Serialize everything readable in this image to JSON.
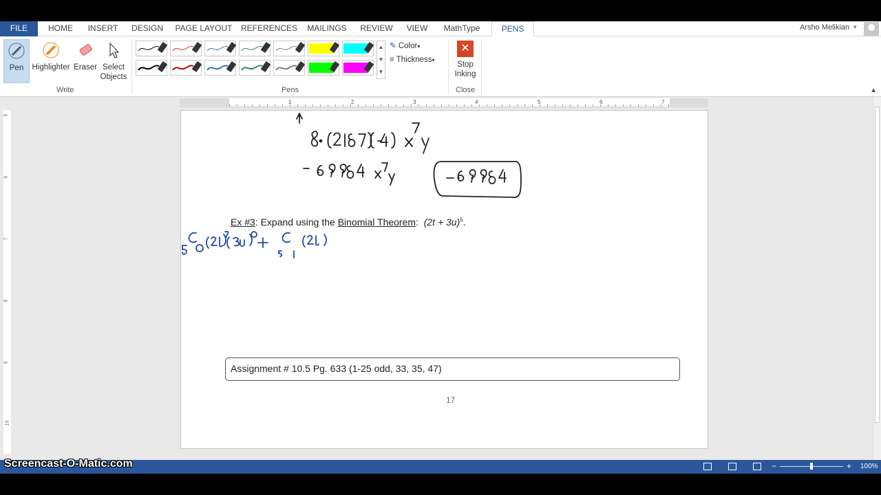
{
  "tabs": [
    "FILE",
    "HOME",
    "INSERT",
    "DESIGN",
    "PAGE LAYOUT",
    "REFERENCES",
    "MAILINGS",
    "REVIEW",
    "VIEW",
    "MathType",
    "PENS"
  ],
  "active_tab": "PENS",
  "user_name": "Arsho Melikian",
  "ribbon": {
    "write_group": {
      "label": "Write",
      "pen": "Pen",
      "highlighter": "Highlighter",
      "eraser": "Eraser",
      "select_line1": "Select",
      "select_line2": "Objects"
    },
    "pens_group": {
      "label": "Pens",
      "color": "Color",
      "thickness": "Thickness"
    },
    "close_group": {
      "label": "Close",
      "stop_line1": "Stop",
      "stop_line2": "Inking"
    },
    "pen_colors": [
      "#000000",
      "#c0392b",
      "#2e75b6",
      "#2e8b57",
      "#808080",
      "#ffff00",
      "#00ffff",
      "#000000",
      "#c00000",
      "#2e75b6",
      "#2e8b57",
      "#808080",
      "#00ff00",
      "#ff00ff"
    ]
  },
  "ruler_numbers": [
    "1",
    "2",
    "3",
    "4",
    "5",
    "6",
    "7"
  ],
  "vruler_numbers": [
    "5",
    "6",
    "7",
    "8",
    "9",
    "10"
  ],
  "document": {
    "ex3_label": "Ex #3",
    "ex3_text": ": Expand using the ",
    "ex3_link": "Binomial Theorem",
    "ex3_colon": ":",
    "ex3_expr": "(2t + 3u)",
    "ex3_exp": "5",
    "ex3_end": ".",
    "assignment": "Assignment # 10.5   Pg. 633 (1-25 odd, 33, 35, 47)",
    "page_number": "17"
  },
  "status": {
    "zoom": "100%",
    "zoom_minus": "−",
    "zoom_plus": "+"
  },
  "watermark": "Screencast-O-Matic.com",
  "ink_color_black": "#222222",
  "ink_color_blue": "#1f4aa0",
  "accent": "#2b579a"
}
